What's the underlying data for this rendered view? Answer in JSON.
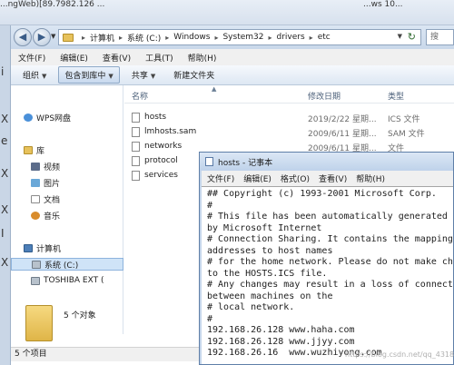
{
  "background_window": {
    "title_fragment": "...ngWeb)[89.7982.126 ...",
    "right_fragment": "...ws 10...",
    "left_fragments": [
      "i",
      "X",
      "e",
      "X",
      "X",
      "I",
      "X"
    ]
  },
  "explorer": {
    "breadcrumb": [
      "计算机",
      "系统 (C:)",
      "Windows",
      "System32",
      "drivers",
      "etc"
    ],
    "search_placeholder": "搜",
    "menu": [
      "文件(F)",
      "编辑(E)",
      "查看(V)",
      "工具(T)",
      "帮助(H)"
    ],
    "toolbar": [
      "组织",
      "包含到库中",
      "共享",
      "新建文件夹"
    ],
    "nav": {
      "favorites": [
        {
          "label": "WPS网盘",
          "icon": "cloud-icon"
        }
      ],
      "library": {
        "label": "库",
        "icon": "library-icon"
      },
      "library_items": [
        {
          "label": "视频",
          "icon": "video-icon"
        },
        {
          "label": "图片",
          "icon": "picture-icon"
        },
        {
          "label": "文档",
          "icon": "document-icon"
        },
        {
          "label": "音乐",
          "icon": "music-icon"
        }
      ],
      "computer": {
        "label": "计算机",
        "icon": "computer-icon"
      },
      "drives": [
        {
          "label": "系统 (C:)",
          "icon": "drive-icon",
          "selected": true
        },
        {
          "label": "TOSHIBA EXT (",
          "icon": "drive-icon",
          "selected": false
        }
      ]
    },
    "columns": [
      "名称",
      "修改日期",
      "类型"
    ],
    "files": [
      {
        "name": "hosts",
        "date": "2019/2/22 星期...",
        "type": "ICS 文件"
      },
      {
        "name": "lmhosts.sam",
        "date": "2009/6/11 星期...",
        "type": "SAM 文件"
      },
      {
        "name": "networks",
        "date": "2009/6/11 星期...",
        "type": "文件"
      },
      {
        "name": "protocol",
        "date": "",
        "type": ""
      },
      {
        "name": "services",
        "date": "",
        "type": ""
      }
    ],
    "details_text": "5 个对象",
    "status": "5 个项目"
  },
  "notepad": {
    "title": "hosts - 记事本",
    "menu": [
      "文件(F)",
      "编辑(E)",
      "格式(O)",
      "查看(V)",
      "帮助(H)"
    ],
    "lines": [
      "## Copyright (c) 1993-2001 Microsoft Corp.",
      "#",
      "# This file has been automatically generated",
      "by Microsoft Internet",
      "# Connection Sharing. It contains the mapping",
      "addresses to host names",
      "# for the home network. Please do not make ch",
      "to the HOSTS.ICS file.",
      "# Any changes may result in a loss of connect",
      "between machines on the",
      "# local network.",
      "#",
      "192.168.26.128 www.haha.com",
      "192.168.26.128 www.jjyy.com",
      "192.168.26.16  www.wuzhiyong.com"
    ]
  },
  "watermark": "https://blog.csdn.net/qq_43181752"
}
